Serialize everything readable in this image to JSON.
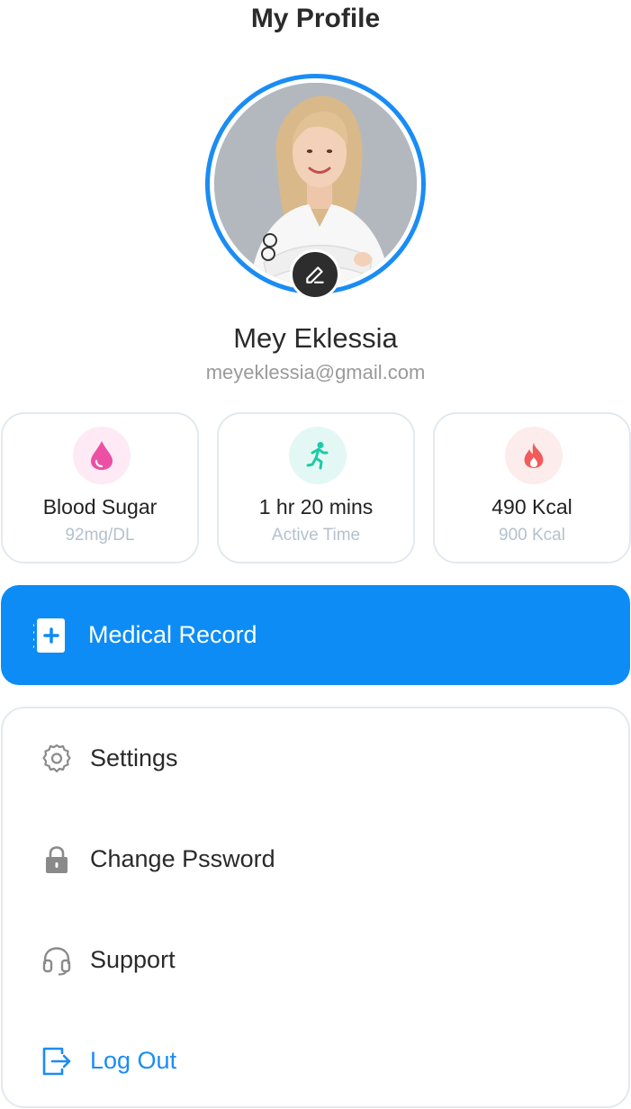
{
  "header": {
    "title": "My Profile"
  },
  "profile": {
    "name": "Mey Eklessia",
    "email": "meyeklessia@gmail.com",
    "avatar_border_color": "#1a8cf5"
  },
  "stats": [
    {
      "icon": "blood-drop-icon",
      "value": "Blood Sugar",
      "label": "92mg/DL",
      "icon_color": "#ec4fa3",
      "icon_bg": "#fdeaf5"
    },
    {
      "icon": "running-person-icon",
      "value": "1 hr 20 mins",
      "label": "Active Time",
      "icon_color": "#1fc9a8",
      "icon_bg": "#e3f8f4"
    },
    {
      "icon": "fire-icon",
      "value": "490 Kcal",
      "label": "900 Kcal",
      "icon_color": "#f25b5b",
      "icon_bg": "#fdecec"
    }
  ],
  "medical_record": {
    "icon": "medical-record-icon",
    "label": "Medical Record",
    "bg_color": "#0d8cf5"
  },
  "menu": [
    {
      "icon": "gear-icon",
      "label": "Settings"
    },
    {
      "icon": "lock-icon",
      "label": "Change Pssword"
    },
    {
      "icon": "headset-icon",
      "label": "Support"
    },
    {
      "icon": "logout-icon",
      "label": "Log Out",
      "color": "#1a8cf5"
    }
  ]
}
